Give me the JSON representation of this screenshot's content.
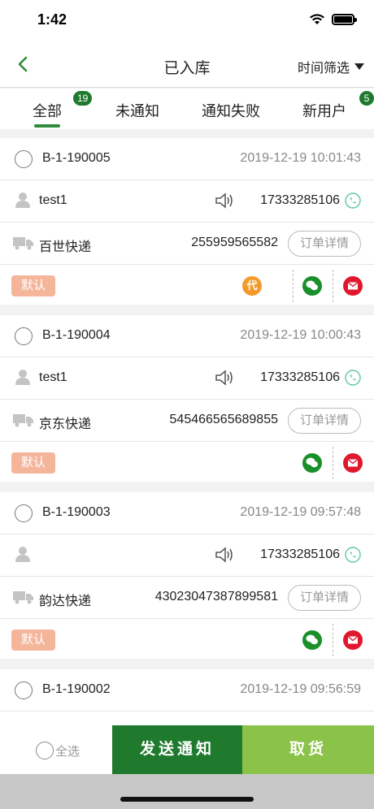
{
  "status": {
    "time": "1:42"
  },
  "nav": {
    "title": "已入库",
    "filter": "时间筛选"
  },
  "tabs": [
    {
      "label": "全部",
      "badge": "19"
    },
    {
      "label": "未通知"
    },
    {
      "label": "通知失败"
    },
    {
      "label": "新用户",
      "badge": "5"
    }
  ],
  "orders": [
    {
      "code": "B-1-190005",
      "time": "2019-12-19 10:01:43",
      "name": "test1",
      "phone": "17333285106",
      "courier": "百世快递",
      "tracking": "255959565582",
      "detail": "订单详情",
      "tag": "默认",
      "dai": "代"
    },
    {
      "code": "B-1-190004",
      "time": "2019-12-19 10:00:43",
      "name": "test1",
      "phone": "17333285106",
      "courier": "京东快递",
      "tracking": "545466565689855",
      "detail": "订单详情",
      "tag": "默认"
    },
    {
      "code": "B-1-190003",
      "time": "2019-12-19 09:57:48",
      "name": "",
      "phone": "17333285106",
      "courier": "韵达快递",
      "tracking": "43023047387899581",
      "detail": "订单详情",
      "tag": "默认"
    },
    {
      "code": "B-1-190002",
      "time": "2019-12-19 09:56:59"
    }
  ],
  "bottom": {
    "select_all": "全选",
    "send": "发送通知",
    "pickup": "取货"
  },
  "colors": {
    "primary": "#1f7a2e",
    "accent": "#8bc34a",
    "tag": "#f5b59a"
  }
}
